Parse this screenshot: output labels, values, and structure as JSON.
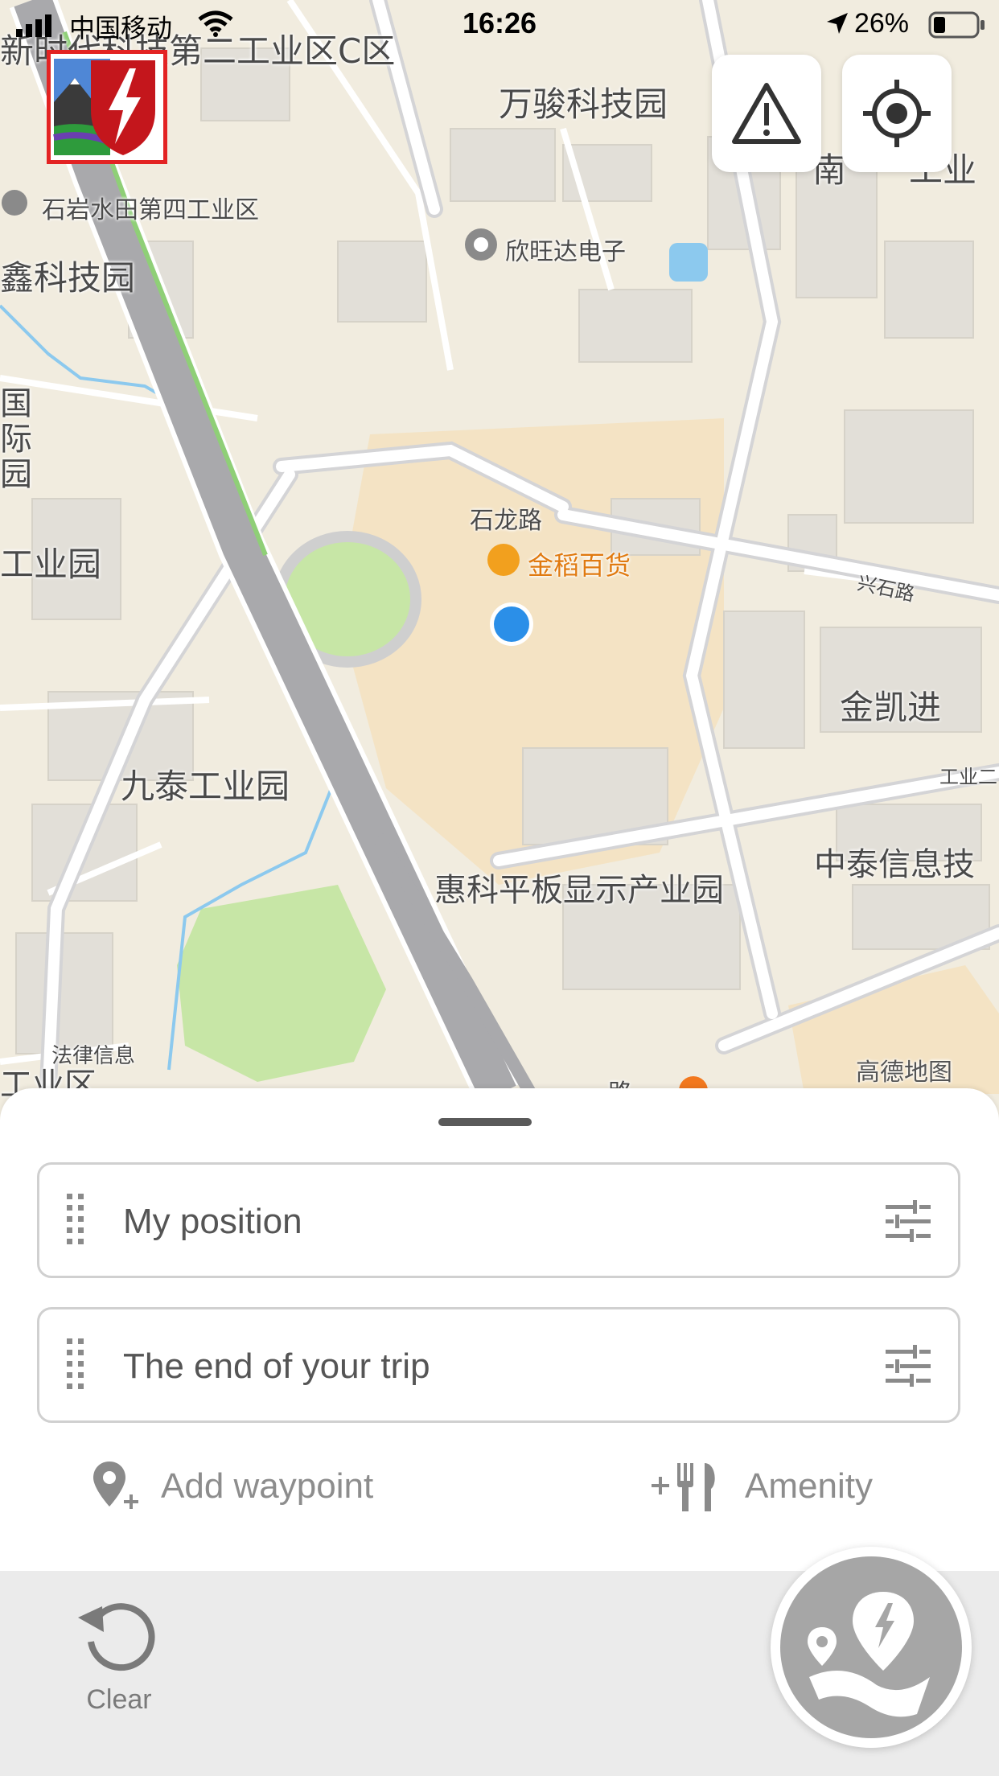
{
  "status_bar": {
    "carrier": "中国移动",
    "time": "16:26",
    "battery": "26%"
  },
  "map": {
    "labels": [
      "新时代科技第二工业区C区",
      "万骏科技园",
      "石岩水田第四工业区",
      "欣旺达电子",
      "鑫科技园",
      "国际 园",
      "石龙路",
      "金稻百货",
      "兴石路",
      "工业园",
      "金凯进",
      "九泰工业园",
      "惠科平板显示产业园",
      "中泰信息技",
      "工业二",
      "法律信息",
      "工业区",
      "高德地图",
      "南",
      "工业",
      "路"
    ],
    "colors": {
      "land": "#f1ecdf",
      "park": "#c7e6a6",
      "highway": "#a9a9ac",
      "water": "#8cc9ee",
      "urban": "#f5dfb8",
      "location_dot": "#2b8fe8"
    }
  },
  "map_buttons": {
    "warning": "warning-icon",
    "locate": "crosshair-icon"
  },
  "app_logo": "app-logo",
  "route": {
    "start_field": "My position",
    "end_field": "The end of your trip",
    "add_waypoint": "Add waypoint",
    "amenity": "Amenity"
  },
  "bottom_bar": {
    "clear_label": "Clear"
  },
  "fab": {
    "icon": "route-charge-icon",
    "color": "#a6a6a6"
  }
}
